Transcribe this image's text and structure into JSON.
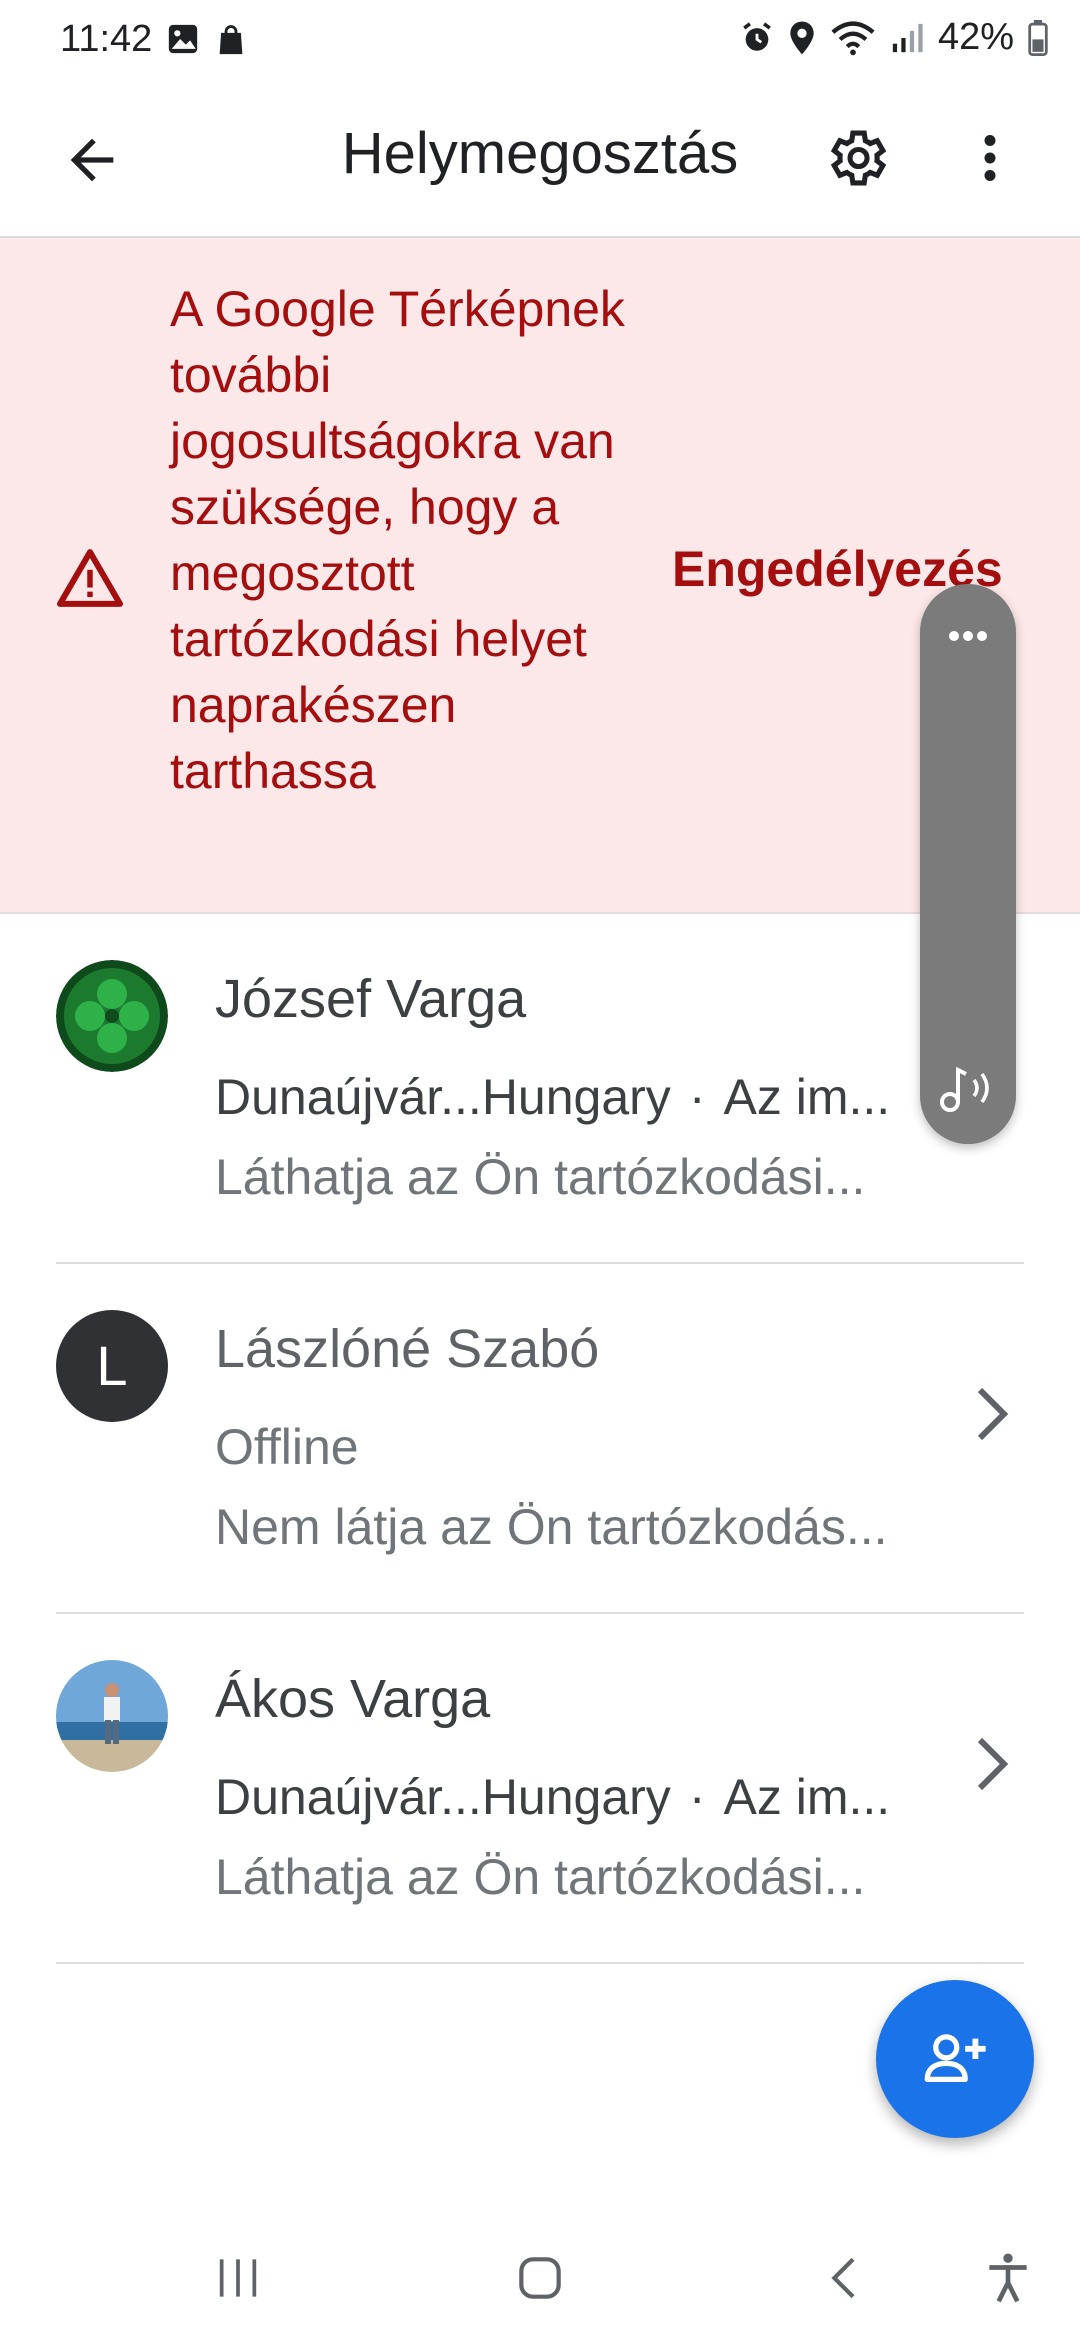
{
  "status_bar": {
    "time": "11:42",
    "battery": "42%",
    "icons": [
      "gallery-icon",
      "shopping-bag-icon",
      "alarm-icon",
      "location-icon",
      "wifi-icon",
      "signal-icon",
      "battery-icon"
    ]
  },
  "app_bar": {
    "title": "Helymegosztás",
    "icons": [
      "back-arrow-icon",
      "gear-icon",
      "more-vert-icon"
    ]
  },
  "banner": {
    "message": "A Google Térképnek további jogosultságokra van szüksége, hogy a megosztott tartózkodási helyet naprakészen tarthassa",
    "action": "Engedélyezés",
    "color": "#a50e0e",
    "background": "#fce8e8"
  },
  "contacts": [
    {
      "name": "József Varga",
      "location": "Dunaújvár...Hungary",
      "time": "Az im...",
      "sub": "Láthatja az Ön tartózkodási..."
    },
    {
      "name": "Lászlóné Szabó",
      "avatar_letter": "L",
      "location": "Offline",
      "sub": "Nem látja az Ön tartózkodás..."
    },
    {
      "name": "Ákos Varga",
      "location": "Dunaújvár...Hungary",
      "time": "Az im...",
      "sub": "Láthatja az Ön tartózkodási..."
    }
  ],
  "separator": "·",
  "fab": {
    "icon": "add-person-icon",
    "color": "#1a73e8"
  },
  "nav_bar": {
    "icons": [
      "recents-icon",
      "home-icon",
      "back-icon",
      "accessibility-icon"
    ]
  }
}
